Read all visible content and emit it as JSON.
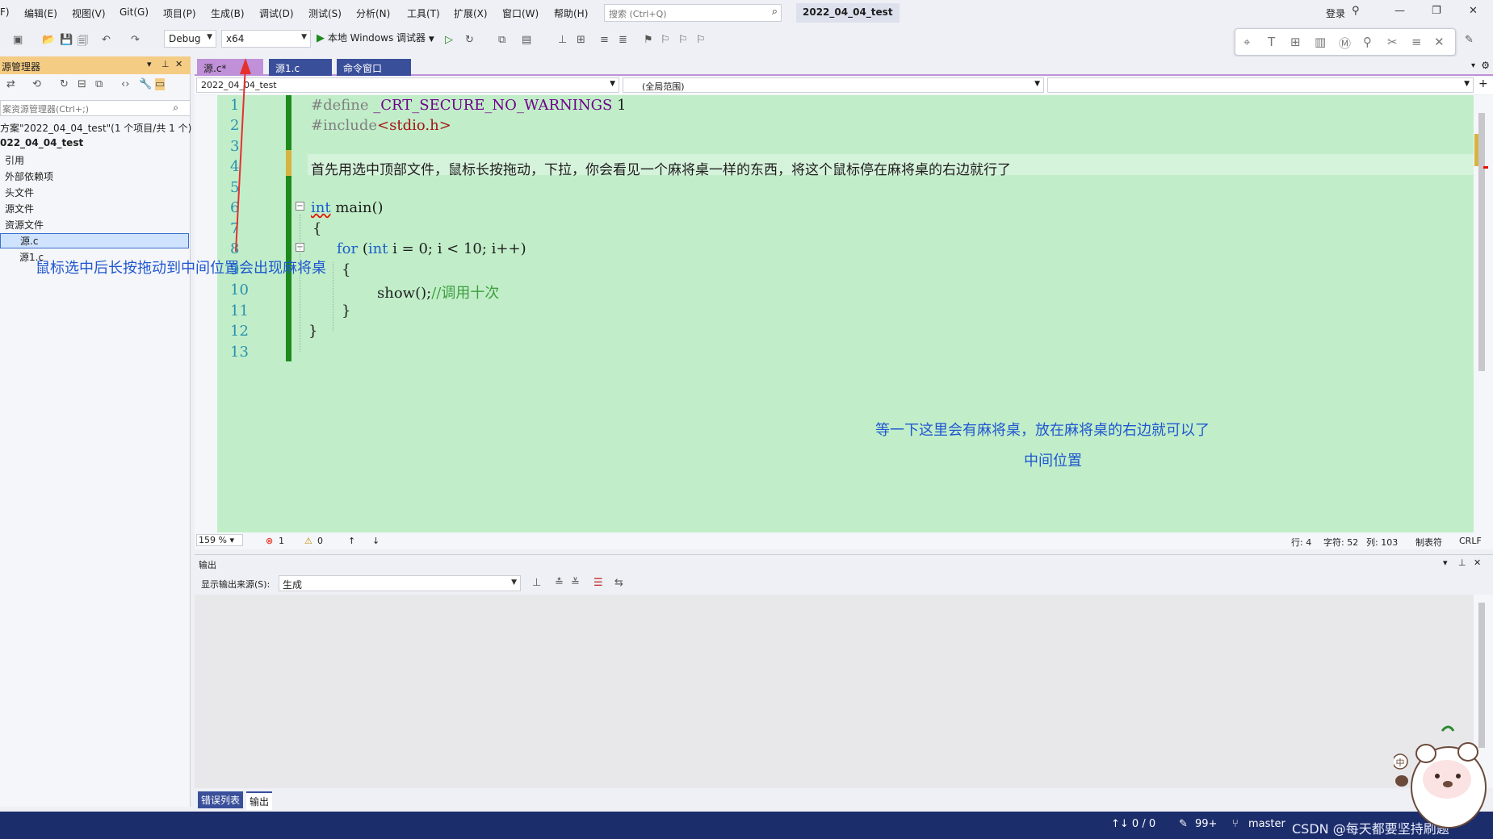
{
  "menu": {
    "items": [
      "F)",
      "编辑(E)",
      "视图(V)",
      "Git(G)",
      "项目(P)",
      "生成(B)",
      "调试(D)",
      "测试(S)",
      "分析(N)",
      "工具(T)",
      "扩展(X)",
      "窗口(W)",
      "帮助(H)"
    ],
    "search_placeholder": "搜索 (Ctrl+Q)",
    "project_name": "2022_04_04_test",
    "login": "登录"
  },
  "toolbar": {
    "config": "Debug",
    "platform": "x64",
    "run_label": "本地 Windows 调试器"
  },
  "solution_explorer": {
    "title": "源管理器",
    "search_placeholder": "案资源管理器(Ctrl+;)",
    "items": [
      "方案\"2022_04_04_test\"(1 个项目/共 1 个)",
      "022_04_04_test",
      "引用",
      "外部依赖项",
      "头文件",
      "源文件",
      "资源文件",
      "源.c",
      "源1.c"
    ]
  },
  "tabs": [
    "源.c*",
    "源1.c",
    "命令窗口"
  ],
  "navbar": {
    "project": "2022_04_04_test",
    "scope": "(全局范围)"
  },
  "editor": {
    "line_numbers": [
      "1",
      "2",
      "3",
      "4",
      "5",
      "6",
      "7",
      "8",
      "9",
      "10",
      "11",
      "12",
      "13"
    ],
    "lines": {
      "l1_pp": "#define ",
      "l1_mac": "_CRT_SECURE_NO_WARNINGS",
      "l1_rest": " 1",
      "l2_pp": "#include",
      "l2_str": "<stdio.h>",
      "l4": "首先用选中顶部文件，鼠标长按拖动，下拉，你会看见一个麻将桌一样的东西，将这个鼠标停在麻将桌的右边就行了",
      "l6_kw": "int",
      "l6_rest": " main()",
      "l7": "{",
      "l8_kw": "for",
      "l8_a": " (",
      "l8_kw2": "int",
      "l8_b": " i = 0; i < 10; i++)",
      "l9": "{",
      "l10_code": "show();",
      "l10_cm": "//调用十次",
      "l11": "}",
      "l12": "}"
    },
    "annotation_left": "鼠标选中后长按拖动到中间位置会出现麻将桌",
    "annotation_right": "等一下这里会有麻将桌，放在麻将桌的右边就可以了",
    "annotation_middle": "中间位置"
  },
  "editor_status": {
    "zoom": "159 %",
    "errors": "1",
    "warnings": "0",
    "row": "行: 4",
    "char": "字符: 52",
    "col": "列: 103",
    "tab": "制表符",
    "eol": "CRLF"
  },
  "output": {
    "title": "输出",
    "source_label": "显示输出来源(S):",
    "source_value": "生成",
    "tabs": [
      "错误列表",
      "输出"
    ]
  },
  "status_bar": {
    "updown": "↑↓ 0 / 0",
    "edits": "99+",
    "branch": "master",
    "watermark": "CSDN @每天都要坚持刷题"
  },
  "colors": {
    "editor_bg": "#c1eec9",
    "statusbar": "#1c2d6b",
    "active_tab": "#c091d8",
    "annotation": "#1f56d0"
  }
}
